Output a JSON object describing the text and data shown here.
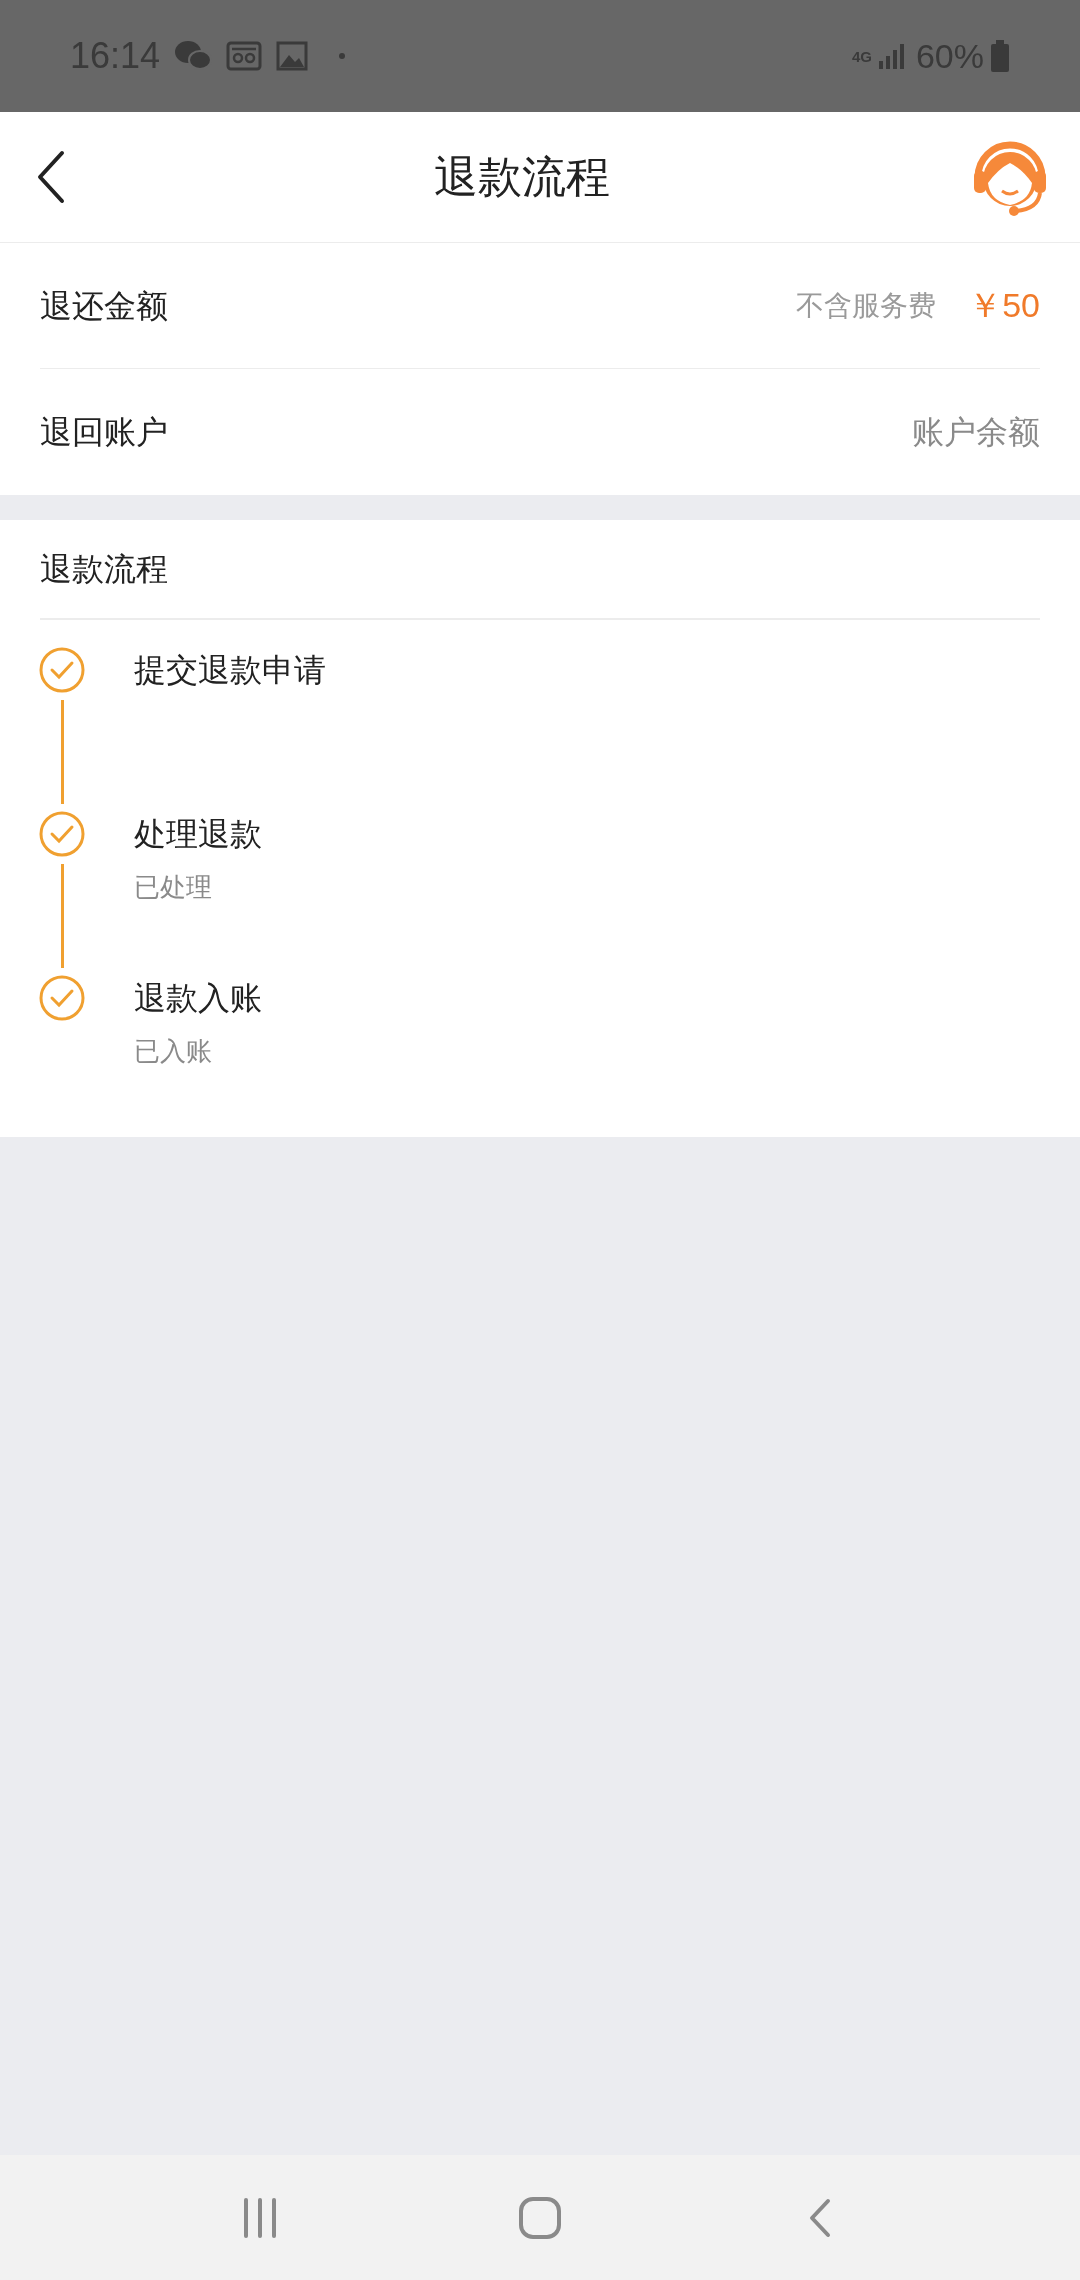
{
  "status_bar": {
    "time": "16:14",
    "network": "4G",
    "battery": "60%"
  },
  "header": {
    "title": "退款流程"
  },
  "info_rows": [
    {
      "label": "退还金额",
      "note": "不含服务费",
      "value": "￥50",
      "highlight": true
    },
    {
      "label": "退回账户",
      "value": "账户余额",
      "highlight": false
    }
  ],
  "progress": {
    "title": "退款流程",
    "steps": [
      {
        "label": "提交退款申请",
        "done": true
      },
      {
        "label": "处理退款",
        "status": "已处理",
        "done": true
      },
      {
        "label": "退款入账",
        "status": "已入账",
        "done": true
      }
    ]
  }
}
